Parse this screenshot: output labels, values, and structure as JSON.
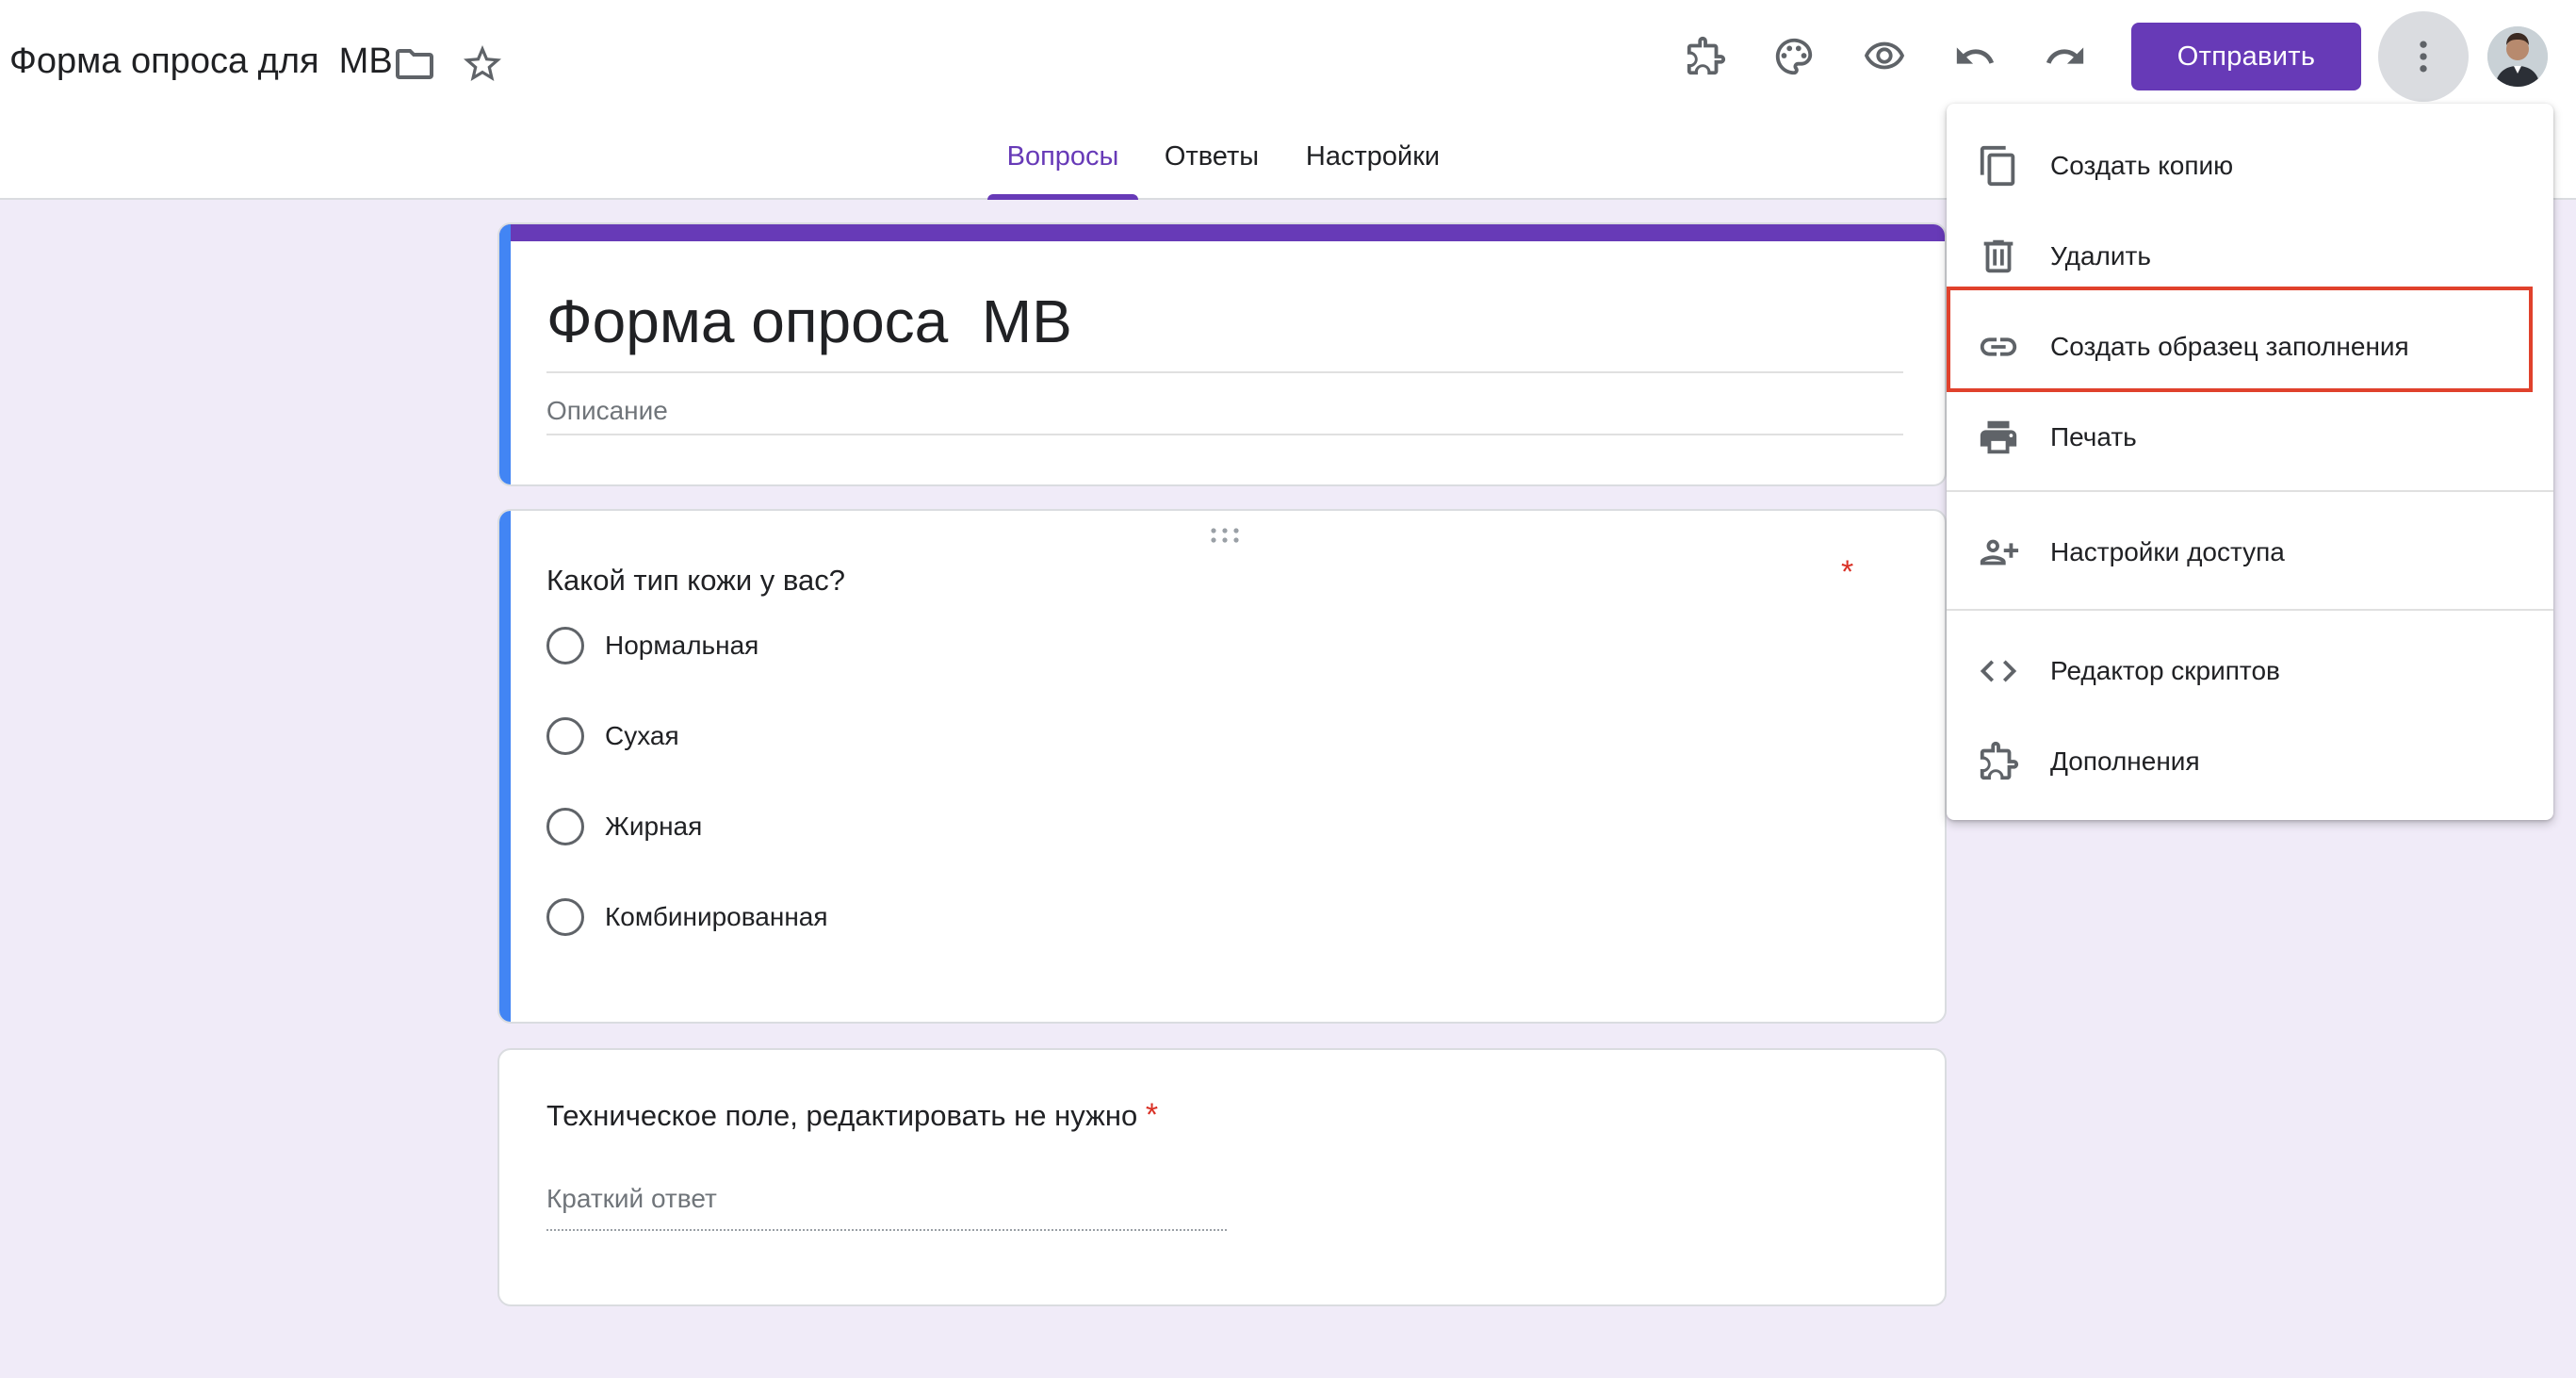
{
  "header": {
    "doc_title": "Форма опроса для  МВ",
    "send_label": "Отправить",
    "icons": [
      "folder-icon",
      "star-icon",
      "addon-icon",
      "palette-icon",
      "preview-icon",
      "undo-icon",
      "redo-icon",
      "more-vert-icon"
    ]
  },
  "tabs": [
    {
      "label": "Вопросы",
      "active": true
    },
    {
      "label": "Ответы",
      "active": false
    },
    {
      "label": "Настройки",
      "active": false
    }
  ],
  "form": {
    "title": "Форма опроса  МВ",
    "description_placeholder": "Описание"
  },
  "questions": [
    {
      "title": "Какой тип кожи у вас?",
      "required_mark": "*",
      "options": [
        "Нормальная",
        "Сухая",
        "Жирная",
        "Комбинированная"
      ]
    },
    {
      "title": "Техническое поле, редактировать не нужно",
      "required_mark": "*",
      "answer_placeholder": "Краткий ответ"
    }
  ],
  "menu": {
    "items": [
      {
        "label": "Создать копию",
        "icon": "copy-icon"
      },
      {
        "label": "Удалить",
        "icon": "trash-icon"
      },
      {
        "label": "Создать образец заполнения",
        "icon": "link-icon",
        "highlighted": true
      },
      {
        "label": "Печать",
        "icon": "print-icon"
      },
      {
        "label": "Настройки доступа",
        "icon": "people-add-icon"
      },
      {
        "label": "Редактор скриптов",
        "icon": "code-icon"
      },
      {
        "label": "Дополнения",
        "icon": "addon-icon"
      }
    ]
  },
  "colors": {
    "accent": "#673ab7",
    "question_accent": "#4285f4",
    "background": "#f0ebf8",
    "highlight": "#e0412c",
    "required": "#d93025"
  }
}
